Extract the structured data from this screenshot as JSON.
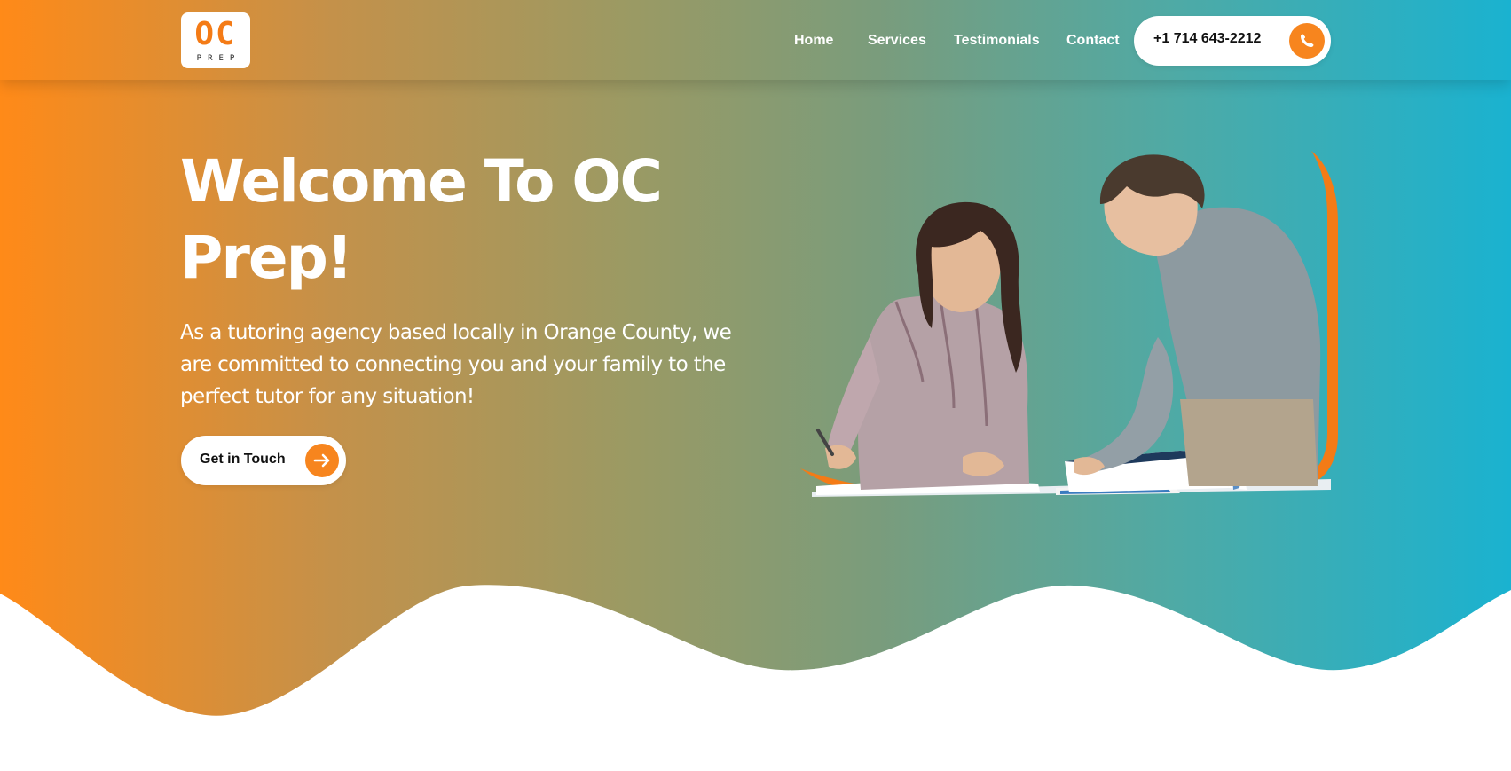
{
  "brand": {
    "logo_main": "OC",
    "logo_sub": "PREP",
    "accent_color": "#f7851e",
    "gradient_start": "#ff8a18",
    "gradient_end": "#1ab2d0"
  },
  "nav": {
    "items": [
      {
        "label": "Home"
      },
      {
        "label": "Services"
      },
      {
        "label": "Testimonials"
      },
      {
        "label": "Contact"
      }
    ],
    "phone": "+1 714 643-2212",
    "phone_icon": "phone-icon"
  },
  "hero": {
    "title": "Welcome To OC Prep!",
    "description": "As a tutoring agency based locally in Orange County, we are committed to connecting you and your family to the perfect tutor for any situation!",
    "cta_label": "Get in Touch",
    "cta_icon": "arrow-right-icon",
    "image_subject": "student-and-tutor-photo"
  }
}
